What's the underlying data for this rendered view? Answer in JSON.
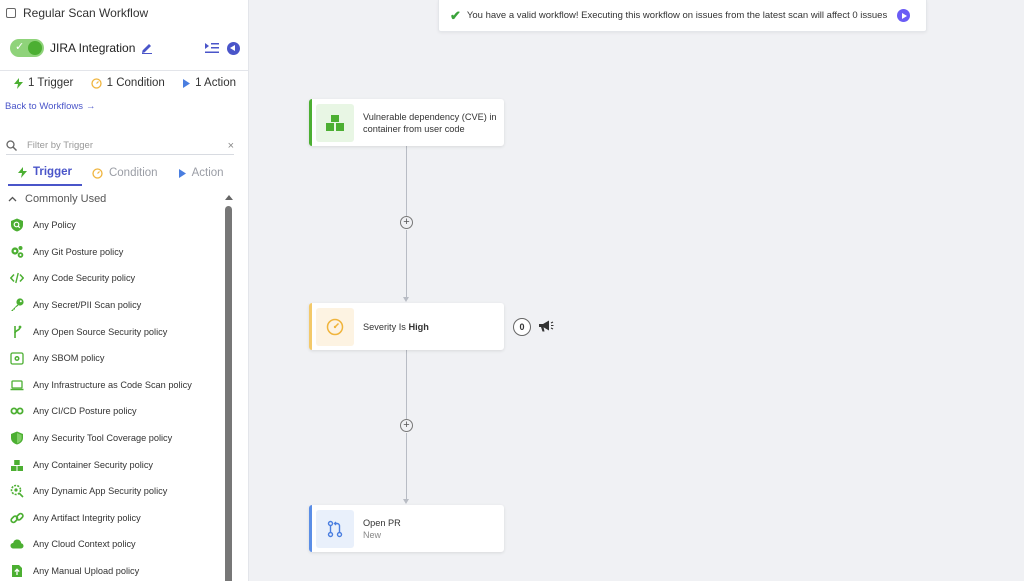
{
  "sidebar": {
    "title": "Regular Scan Workflow",
    "workflow_name": "JIRA Integration",
    "toggle_on": true,
    "counts": {
      "trigger": "1 Trigger",
      "condition": "1 Condition",
      "action": "1 Action"
    },
    "back_link": "Back to Workflows",
    "filter": {
      "placeholder": "Filter by Trigger",
      "value": ""
    },
    "tabs": [
      {
        "label": "Trigger",
        "active": true
      },
      {
        "label": "Condition",
        "active": false
      },
      {
        "label": "Action",
        "active": false
      }
    ],
    "section_title": "Commonly Used",
    "items": [
      {
        "label": "Any Policy",
        "icon": "policy-search-icon"
      },
      {
        "label": "Any Git Posture policy",
        "icon": "gears-icon"
      },
      {
        "label": "Any Code Security policy",
        "icon": "code-icon"
      },
      {
        "label": "Any Secret/PII Scan policy",
        "icon": "key-icon"
      },
      {
        "label": "Any Open Source Security policy",
        "icon": "branch-icon"
      },
      {
        "label": "Any SBOM policy",
        "icon": "sbom-icon"
      },
      {
        "label": "Any Infrastructure as Code Scan policy",
        "icon": "laptop-icon"
      },
      {
        "label": "Any CI/CD Posture policy",
        "icon": "infinity-icon"
      },
      {
        "label": "Any Security Tool Coverage policy",
        "icon": "shield-icon"
      },
      {
        "label": "Any Container Security policy",
        "icon": "containers-icon"
      },
      {
        "label": "Any Dynamic App Security policy",
        "icon": "dynamic-gear-icon"
      },
      {
        "label": "Any Artifact Integrity policy",
        "icon": "link-icon"
      },
      {
        "label": "Any Cloud Context policy",
        "icon": "cloud-icon"
      },
      {
        "label": "Any Manual Upload policy",
        "icon": "upload-icon"
      }
    ]
  },
  "banner": {
    "message": "You have a valid workflow! Executing this workflow on issues from the latest scan will affect 0 issues"
  },
  "flow": {
    "trigger": {
      "line1": "Vulnerable dependency (CVE) in",
      "line2": "container from user code"
    },
    "condition": {
      "prefix": "Severity Is",
      "value": "High",
      "count": "0"
    },
    "action": {
      "title": "Open PR",
      "status": "New"
    }
  },
  "colors": {
    "accent": "#4a55c9",
    "trigger": "#4caf32",
    "condition": "#f3c96a",
    "action": "#5b8ee6"
  }
}
